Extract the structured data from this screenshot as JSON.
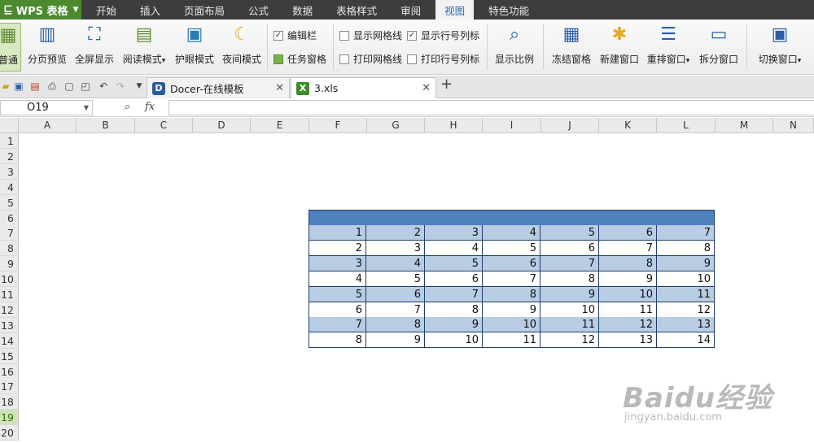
{
  "app": {
    "name": "WPS 表格"
  },
  "menu": [
    "开始",
    "插入",
    "页面布局",
    "公式",
    "数据",
    "表格样式",
    "审阅",
    "视图",
    "特色功能"
  ],
  "menu_active": "视图",
  "ribbon": {
    "buttons": [
      {
        "label": "普通",
        "icon": "normal-view-icon"
      },
      {
        "label": "分页预览",
        "icon": "page-break-preview-icon"
      },
      {
        "label": "全屏显示",
        "icon": "fullscreen-icon"
      },
      {
        "label": "阅读模式",
        "icon": "reading-mode-icon",
        "dropdown": "▾"
      },
      {
        "label": "护眼模式",
        "icon": "eye-protection-icon"
      },
      {
        "label": "夜间模式",
        "icon": "night-mode-icon"
      },
      {
        "label": "显示比例",
        "icon": "zoom-icon"
      },
      {
        "label": "冻结窗格",
        "icon": "freeze-panes-icon"
      },
      {
        "label": "新建窗口",
        "icon": "new-window-icon"
      },
      {
        "label": "重排窗口",
        "icon": "arrange-windows-icon",
        "dropdown": "▾"
      },
      {
        "label": "拆分窗口",
        "icon": "split-window-icon"
      },
      {
        "label": "切换窗口",
        "icon": "switch-window-icon",
        "dropdown": "▾"
      }
    ],
    "checks": [
      {
        "label": "编辑栏",
        "checked": true
      },
      {
        "label": "任务窗格",
        "checked": true
      },
      {
        "label": "显示网格线",
        "checked": false
      },
      {
        "label": "显示行号列标",
        "checked": true
      },
      {
        "label": "打印网格线",
        "checked": false
      },
      {
        "label": "打印行号列标",
        "checked": false
      }
    ]
  },
  "tabs": [
    {
      "title": "Docer-在线模板",
      "icon": "D",
      "close": "✕"
    },
    {
      "title": "3.xls",
      "icon": "X",
      "close": "✕"
    }
  ],
  "new_tab": "+",
  "formula_bar": {
    "cell_ref": "O19",
    "fx_label": "fx",
    "value": ""
  },
  "columns": [
    "A",
    "B",
    "C",
    "D",
    "E",
    "F",
    "G",
    "H",
    "I",
    "J",
    "K",
    "L",
    "M",
    "N"
  ],
  "rows": [
    "1",
    "2",
    "3",
    "4",
    "5",
    "6",
    "7",
    "8",
    "9",
    "10",
    "11",
    "12",
    "13",
    "14",
    "15",
    "16",
    "17",
    "18",
    "19",
    "20"
  ],
  "selected_row": "19",
  "table": {
    "rows": [
      [
        1,
        2,
        3,
        4,
        5,
        6,
        7
      ],
      [
        2,
        3,
        4,
        5,
        6,
        7,
        8
      ],
      [
        3,
        4,
        5,
        6,
        7,
        8,
        9
      ],
      [
        4,
        5,
        6,
        7,
        8,
        9,
        10
      ],
      [
        5,
        6,
        7,
        8,
        9,
        10,
        11
      ],
      [
        6,
        7,
        8,
        9,
        10,
        11,
        12
      ],
      [
        7,
        8,
        9,
        10,
        11,
        12,
        13
      ],
      [
        8,
        9,
        10,
        11,
        12,
        13,
        14
      ]
    ],
    "header_color": "#4f81bd",
    "band_color": "#b8cce4"
  },
  "watermark": {
    "brand": "Baidu经验",
    "url": "jingyan.baidu.com"
  },
  "colors": {
    "menubar": "#3d3d3d",
    "app_button": "#4b8a2e",
    "active_menu_text": "#2b6fb6",
    "selected_row_header": "#cfe3b3"
  }
}
